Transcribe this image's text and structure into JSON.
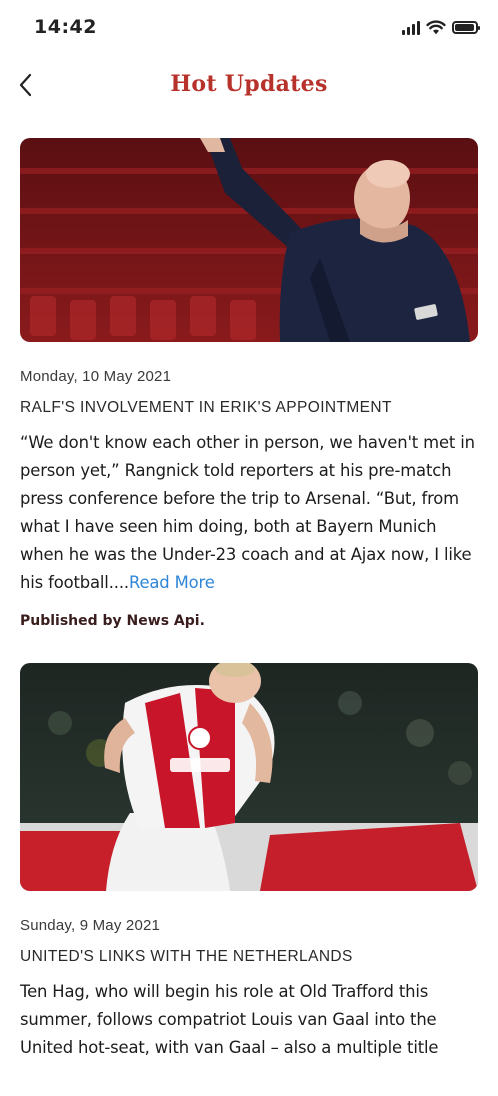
{
  "status_bar": {
    "time": "14:42",
    "battery_level": 0.85
  },
  "header": {
    "back_icon": "chevron-left-icon",
    "title": "Hot Updates"
  },
  "colors": {
    "title": "#b7322b",
    "link": "#2f86d8"
  },
  "articles": [
    {
      "date": "Monday, 10 May 2021",
      "headline": "RALF'S INVOLVEMENT IN ERIK'S APPOINTMENT",
      "body": "“We don't know each other in person, we haven't met in person yet,” Rangnick told reporters at his pre-match press conference before the trip to Arsenal. “But, from what I have seen him doing, both at Bayern Munich when he was the Under-23 coach and at Ajax now, I like his football....",
      "read_more": "Read More",
      "source": "Published by News Api."
    },
    {
      "date": "Sunday, 9 May 2021",
      "headline": "UNITED'S LINKS WITH THE NETHERLANDS",
      "body": "Ten Hag, who will begin his role at Old Trafford this summer, follows compatriot Louis van Gaal into the United hot-seat, with van Gaal – also a multiple title"
    }
  ]
}
